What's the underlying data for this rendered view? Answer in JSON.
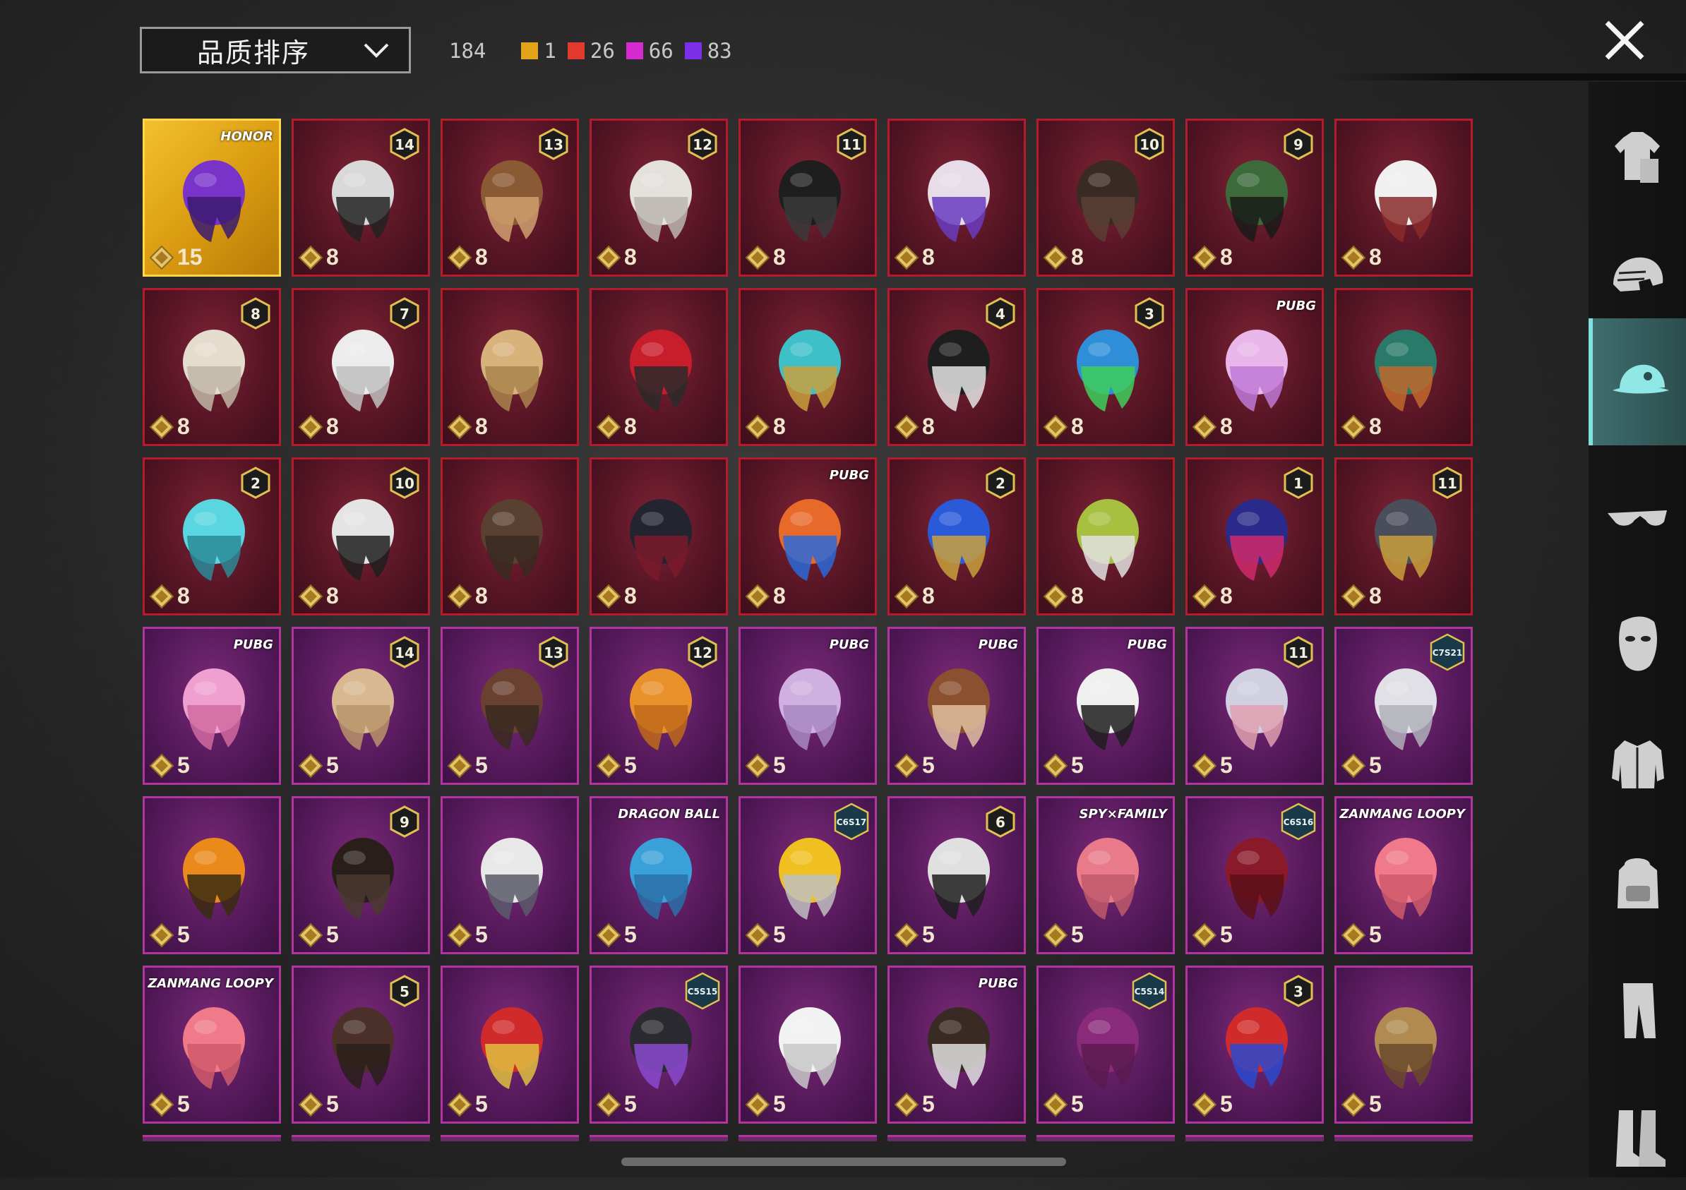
{
  "sort": {
    "label": "品质排序"
  },
  "counts": {
    "total": "184",
    "items": [
      {
        "color": "#e3a41b",
        "value": "1"
      },
      {
        "color": "#e23a2e",
        "value": "26"
      },
      {
        "color": "#d62bd0",
        "value": "66"
      },
      {
        "color": "#7b2fe6",
        "value": "83"
      }
    ]
  },
  "sidebar": {
    "items": [
      {
        "icon": "outfit-icon",
        "active": false
      },
      {
        "icon": "helmet-icon",
        "active": false
      },
      {
        "icon": "cap-icon",
        "active": true
      },
      {
        "icon": "glasses-icon",
        "active": false
      },
      {
        "icon": "mask-icon",
        "active": false
      },
      {
        "icon": "jacket-icon",
        "active": false
      },
      {
        "icon": "backpack-icon",
        "active": false
      },
      {
        "icon": "pants-icon",
        "active": false
      },
      {
        "icon": "boots-icon",
        "active": false
      }
    ]
  },
  "grid": {
    "rows": [
      [
        {
          "tier": "gold",
          "value": "15",
          "badge": {
            "type": "logo",
            "text": "HONOR"
          },
          "art": "gold-hat"
        },
        {
          "tier": "red",
          "value": "8",
          "badge": {
            "type": "num",
            "text": "14"
          },
          "art": "masked-hair"
        },
        {
          "tier": "red",
          "value": "8",
          "badge": {
            "type": "num",
            "text": "13"
          },
          "art": "hat-hair"
        },
        {
          "tier": "red",
          "value": "8",
          "badge": {
            "type": "num",
            "text": "12"
          },
          "art": "white-hair"
        },
        {
          "tier": "red",
          "value": "8",
          "badge": {
            "type": "num",
            "text": "11"
          },
          "art": "black-hair"
        },
        {
          "tier": "red",
          "value": "8",
          "badge": null,
          "art": "horn-hair"
        },
        {
          "tier": "red",
          "value": "8",
          "badge": {
            "type": "num",
            "text": "10"
          },
          "art": "dark-hair"
        },
        {
          "tier": "red",
          "value": "8",
          "badge": {
            "type": "num",
            "text": "9"
          },
          "art": "green-head"
        },
        {
          "tier": "red",
          "value": "8",
          "badge": null,
          "art": "cowboy-hat"
        }
      ],
      [
        {
          "tier": "red",
          "value": "8",
          "badge": {
            "type": "num",
            "text": "8"
          },
          "art": "blond-hair"
        },
        {
          "tier": "red",
          "value": "8",
          "badge": {
            "type": "num",
            "text": "7"
          },
          "art": "long-white-hair"
        },
        {
          "tier": "red",
          "value": "8",
          "badge": null,
          "art": "blond-long-hair"
        },
        {
          "tier": "red",
          "value": "8",
          "badge": null,
          "art": "red-helmet"
        },
        {
          "tier": "red",
          "value": "8",
          "badge": null,
          "art": "horned-helmet"
        },
        {
          "tier": "red",
          "value": "8",
          "badge": {
            "type": "num",
            "text": "4"
          },
          "art": "top-hat-head"
        },
        {
          "tier": "red",
          "value": "8",
          "badge": {
            "type": "num",
            "text": "3"
          },
          "art": "joker-head"
        },
        {
          "tier": "red",
          "value": "8",
          "badge": {
            "type": "logo",
            "text": "PUBG"
          },
          "art": "pink-hair"
        },
        {
          "tier": "red",
          "value": "8",
          "badge": null,
          "art": "dragon-helmet"
        }
      ],
      [
        {
          "tier": "red",
          "value": "8",
          "badge": {
            "type": "num",
            "text": "2"
          },
          "art": "bucket-hat"
        },
        {
          "tier": "red",
          "value": "8",
          "badge": {
            "type": "num",
            "text": "10"
          },
          "art": "rooster-hat"
        },
        {
          "tier": "red",
          "value": "8",
          "badge": null,
          "art": "brown-hair"
        },
        {
          "tier": "red",
          "value": "8",
          "badge": null,
          "art": "black-helmet"
        },
        {
          "tier": "red",
          "value": "8",
          "badge": {
            "type": "logo",
            "text": "PUBG"
          },
          "art": "fire-helmet"
        },
        {
          "tier": "red",
          "value": "8",
          "badge": {
            "type": "num",
            "text": "2"
          },
          "art": "blue-helmet"
        },
        {
          "tier": "red",
          "value": "8",
          "badge": null,
          "art": "green-mask"
        },
        {
          "tier": "red",
          "value": "8",
          "badge": {
            "type": "num",
            "text": "1"
          },
          "art": "blue-mask"
        },
        {
          "tier": "red",
          "value": "8",
          "badge": {
            "type": "num",
            "text": "11"
          },
          "art": "armor-helmet"
        }
      ],
      [
        {
          "tier": "purple",
          "value": "5",
          "badge": {
            "type": "logo",
            "text": "PUBG"
          },
          "art": "bow-headband"
        },
        {
          "tier": "purple",
          "value": "5",
          "badge": {
            "type": "num",
            "text": "14"
          },
          "art": "flower-hair"
        },
        {
          "tier": "purple",
          "value": "5",
          "badge": {
            "type": "num",
            "text": "13"
          },
          "art": "goggles-hair"
        },
        {
          "tier": "purple",
          "value": "5",
          "badge": {
            "type": "num",
            "text": "12"
          },
          "art": "orange-hair"
        },
        {
          "tier": "purple",
          "value": "5",
          "badge": {
            "type": "logo",
            "text": "PUBG"
          },
          "art": "lilac-hair"
        },
        {
          "tier": "purple",
          "value": "5",
          "badge": {
            "type": "logo",
            "text": "PUBG"
          },
          "art": "lion-head"
        },
        {
          "tier": "purple",
          "value": "5",
          "badge": {
            "type": "logo",
            "text": "PUBG"
          },
          "art": "panda-head"
        },
        {
          "tier": "purple",
          "value": "5",
          "badge": {
            "type": "num",
            "text": "11"
          },
          "art": "flower-crown"
        },
        {
          "tier": "purple",
          "value": "5",
          "badge": {
            "type": "season",
            "text": "C7S21"
          },
          "art": "silver-hair"
        }
      ],
      [
        {
          "tier": "purple",
          "value": "5",
          "badge": null,
          "art": "pumpkin-head"
        },
        {
          "tier": "purple",
          "value": "5",
          "badge": {
            "type": "num",
            "text": "9"
          },
          "art": "long-dark-hair"
        },
        {
          "tier": "purple",
          "value": "5",
          "badge": null,
          "art": "wolf-hood"
        },
        {
          "tier": "purple",
          "value": "5",
          "badge": {
            "type": "logo",
            "text": "DRAGON BALL"
          },
          "art": "blue-spiky-hair"
        },
        {
          "tier": "purple",
          "value": "5",
          "badge": {
            "type": "season",
            "text": "C6S17"
          },
          "art": "visor-hair"
        },
        {
          "tier": "purple",
          "value": "5",
          "badge": {
            "type": "num",
            "text": "6"
          },
          "art": "knight-helmet"
        },
        {
          "tier": "purple",
          "value": "5",
          "badge": {
            "type": "logo",
            "text": "SPY×FAMILY"
          },
          "art": "pink-bob"
        },
        {
          "tier": "purple",
          "value": "5",
          "badge": {
            "type": "season",
            "text": "C6S16"
          },
          "art": "red-bob"
        },
        {
          "tier": "purple",
          "value": "5",
          "badge": {
            "type": "logo",
            "text": "ZANMANG LOOPY"
          },
          "art": "loopy-head"
        }
      ],
      [
        {
          "tier": "purple",
          "value": "5",
          "badge": {
            "type": "logo",
            "text": "ZANMANG LOOPY"
          },
          "art": "loopy-head"
        },
        {
          "tier": "purple",
          "value": "5",
          "badge": {
            "type": "num",
            "text": "5"
          },
          "art": "cat-ear-hair"
        },
        {
          "tier": "purple",
          "value": "5",
          "badge": null,
          "art": "dragon-mask"
        },
        {
          "tier": "purple",
          "value": "5",
          "badge": {
            "type": "season",
            "text": "C5S15"
          },
          "art": "baseball-cap"
        },
        {
          "tier": "purple",
          "value": "5",
          "badge": null,
          "art": "polar-bear-head"
        },
        {
          "tier": "purple",
          "value": "5",
          "badge": {
            "type": "logo",
            "text": "PUBG"
          },
          "art": "tiara-hair"
        },
        {
          "tier": "purple",
          "value": "5",
          "badge": {
            "type": "season",
            "text": "C5S14"
          },
          "art": "magenta-hair"
        },
        {
          "tier": "purple",
          "value": "5",
          "badge": {
            "type": "num",
            "text": "3"
          },
          "art": "jester-hat"
        },
        {
          "tier": "purple",
          "value": "5",
          "badge": null,
          "art": "sun-hat"
        }
      ]
    ]
  },
  "colors": {
    "red_tier": "#b21c2c",
    "purple_tier": "#b0359e",
    "gold_tier": "#ffd64a",
    "sidebar_active": "#7fe0df"
  }
}
